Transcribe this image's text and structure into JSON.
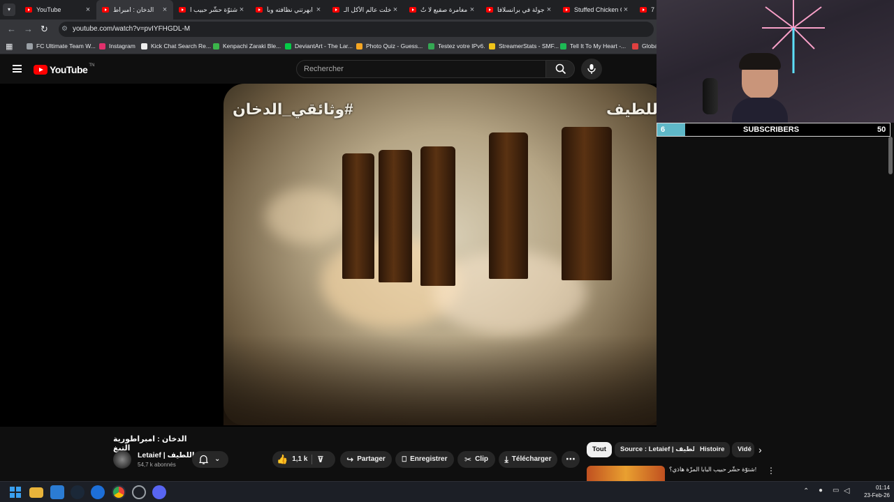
{
  "browser": {
    "tabs": [
      {
        "title": "YouTube",
        "active": false
      },
      {
        "title": "الدخان : امبراط",
        "active": true
      },
      {
        "title": "شتوّة حشّر حبيب ا",
        "active": false
      },
      {
        "title": "ابهرتني نظافته وبأ",
        "active": false
      },
      {
        "title": "دخلت عالم الأكل الـ",
        "active": false
      },
      {
        "title": "مغامرة صقيع لا تُ",
        "active": false
      },
      {
        "title": "جولة في برانسلافا",
        "active": false
      },
      {
        "title": "Stuffed Chicken C",
        "active": false
      },
      {
        "title": "7",
        "active": false
      }
    ],
    "url": "youtube.com/watch?v=pvIYFHGDL-M",
    "bookmarks": [
      "FC Ultimate Team W...",
      "Instagram",
      "Kick Chat Search Re...",
      "Kenpachi Zaraki Ble...",
      "DeviantArt - The Lar...",
      "Photo Quiz - Guess...",
      "Testez votre IPv6.",
      "StreamerStats - SMF...",
      "Tell It To My Heart -...",
      "Globa"
    ]
  },
  "youtube": {
    "logo": "YouTube",
    "logo_region": "TN",
    "search_placeholder": "Rechercher"
  },
  "video": {
    "overlay_left": "#وثائقي_الدخان",
    "overlay_right": "اللطيف",
    "title": "الدخان : امبراطورية التبغ",
    "channel": "Letaief | اللطيف",
    "subscribers": "54,7 k abonnés",
    "likes": "1,1 k",
    "share": "Partager",
    "save": "Enregistrer",
    "clip": "Clip",
    "download": "Télécharger"
  },
  "chips": [
    "Tout",
    "Source : Letaief | اللطيف",
    "Histoire",
    "Vidé"
  ],
  "recommended": {
    "title": "شتوّة حشّر حبيب البابا المزّة هاذي؟!"
  },
  "subscriber_goal": {
    "current": "6",
    "label": "SUBSCRIBERS",
    "goal": "50",
    "progress": 0.12
  },
  "taskbar": {
    "time": "01:14",
    "date": "23-Feb-26"
  }
}
